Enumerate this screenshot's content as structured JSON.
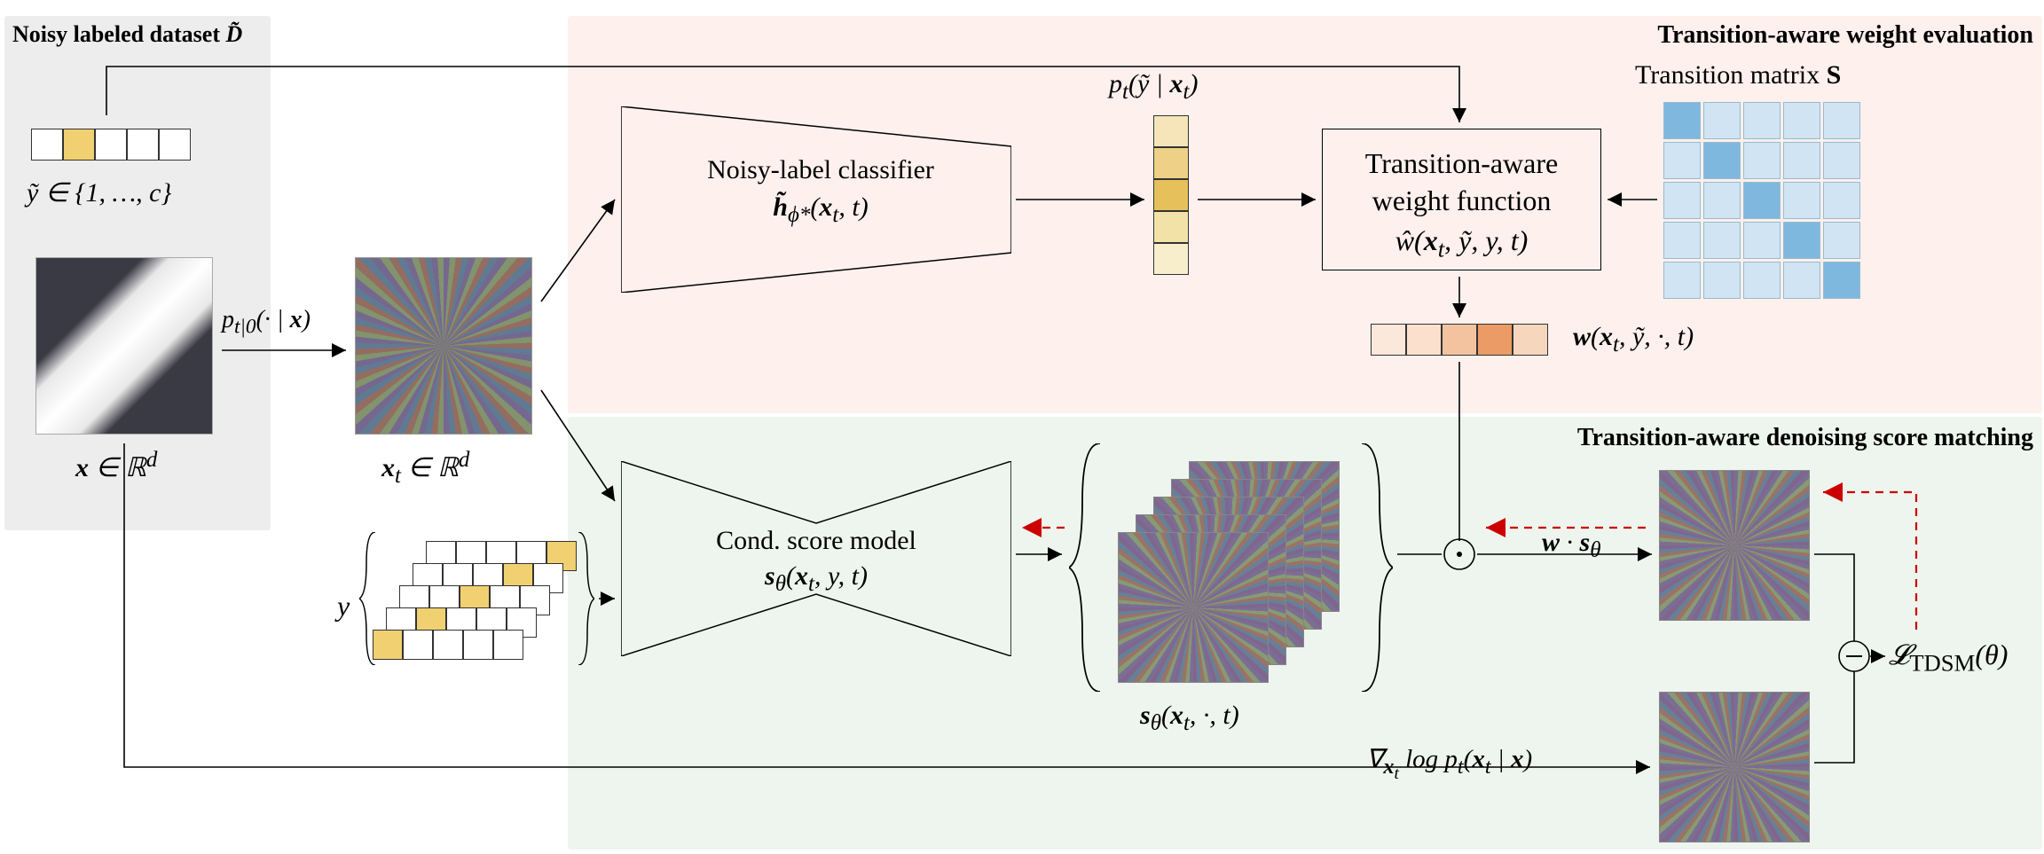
{
  "titles": {
    "dataset": "Noisy labeled dataset ",
    "dataset_sym": "D̃",
    "weight_eval": "Transition-aware weight evaluation",
    "dsm": "Transition-aware denoising score matching",
    "trans_matrix": "Transition matrix "
  },
  "math": {
    "ytilde_set": "ỹ ∈ {1, …, c}",
    "x_in_rd": "x ∈ ℝ",
    "x_exp": "d",
    "xt_in_rd": "xₜ ∈ ℝ",
    "p_t0": "p_{t|0}(· | x)",
    "y_label": "y",
    "classifier_line1": "Noisy-label classifier",
    "classifier_line2": "h̃_{ϕ*}(xₜ, t)",
    "p_ytilde": "pₜ(ỹ | xₜ)",
    "weight_line1": "Transition-aware",
    "weight_line2": "weight function",
    "weight_line3": "ŵ(xₜ, ỹ, y, t)",
    "S": "S",
    "w_vec": "w(xₜ, ỹ, ·, t)",
    "score_line1": "Cond. score model",
    "score_line2": "s_θ(xₜ, y, t)",
    "score_stack": "s_θ(xₜ, ·, t)",
    "w_dot_s": "w · s_θ",
    "grad": "∇_{xₜ} log pₜ(xₜ | x)",
    "loss": "𝓛_TDSM(θ)"
  },
  "colors": {
    "orange": [
      "#fbe6d8",
      "#fbe0cc",
      "#f8d0b0",
      "#f0b088",
      "#f8d8c0"
    ],
    "yellow": [
      "#f0e0a0",
      "#efd88c",
      "#e8c060",
      "#f3e4b0"
    ]
  }
}
